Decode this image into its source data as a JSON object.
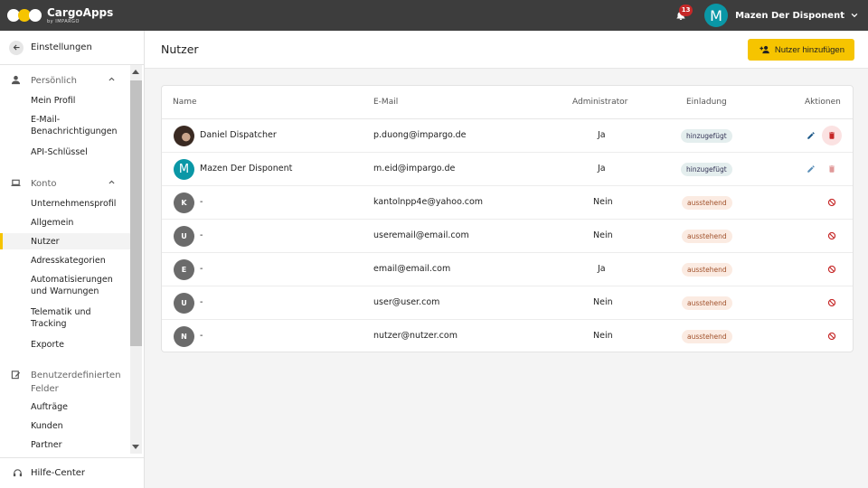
{
  "topbar": {
    "app_name": "CargoApps",
    "app_sub": "by IMPARGO",
    "notification_count": "13",
    "user_initial": "M",
    "user_name": "Mazen Der Disponent"
  },
  "sidebar": {
    "back_label": "Einstellungen",
    "sections": {
      "personal": {
        "label": "Persönlich",
        "items": [
          "Mein Profil",
          "E-Mail-Benachrichtigungen",
          "API-Schlüssel"
        ]
      },
      "account": {
        "label": "Konto",
        "items": [
          "Unternehmensprofil",
          "Allgemein",
          "Nutzer",
          "Adresskategorien",
          "Automatisierungen und Warnungen",
          "Telematik und Tracking",
          "Exporte"
        ]
      },
      "custom": {
        "label": "Benutzerdefinierten Felder",
        "items": [
          "Aufträge",
          "Kunden",
          "Partner"
        ]
      }
    },
    "active_item": "Nutzer",
    "help_label": "Hilfe-Center"
  },
  "main": {
    "title": "Nutzer",
    "add_button_label": "Nutzer hinzufügen"
  },
  "table": {
    "columns": [
      "Name",
      "E-Mail",
      "Administrator",
      "Einladung",
      "Aktionen"
    ],
    "rows": [
      {
        "initial": "",
        "avatar": "photo",
        "name": "Daniel Dispatcher",
        "email": "p.duong@impargo.de",
        "admin": "Ja",
        "invitation": "hinzugefügt",
        "status": "ok",
        "actions": "edit-delete-active"
      },
      {
        "initial": "M",
        "avatar": "teal",
        "name": "Mazen Der Disponent",
        "email": "m.eid@impargo.de",
        "admin": "Ja",
        "invitation": "hinzugefügt",
        "status": "ok",
        "actions": "edit-delete-muted"
      },
      {
        "initial": "K",
        "avatar": "gray",
        "name": "-",
        "email": "kantolnpp4e@yahoo.com",
        "admin": "Nein",
        "invitation": "ausstehend",
        "status": "pending",
        "actions": "revoke"
      },
      {
        "initial": "U",
        "avatar": "gray",
        "name": "-",
        "email": "useremail@email.com",
        "admin": "Nein",
        "invitation": "ausstehend",
        "status": "pending",
        "actions": "revoke"
      },
      {
        "initial": "E",
        "avatar": "gray",
        "name": "-",
        "email": "email@email.com",
        "admin": "Ja",
        "invitation": "ausstehend",
        "status": "pending",
        "actions": "revoke"
      },
      {
        "initial": "U",
        "avatar": "gray",
        "name": "-",
        "email": "user@user.com",
        "admin": "Nein",
        "invitation": "ausstehend",
        "status": "pending",
        "actions": "revoke"
      },
      {
        "initial": "N",
        "avatar": "gray",
        "name": "-",
        "email": "nutzer@nutzer.com",
        "admin": "Nein",
        "invitation": "ausstehend",
        "status": "pending",
        "actions": "revoke"
      }
    ]
  },
  "colors": {
    "topbar": "#3d3d3d",
    "accent": "#f6c400",
    "teal": "#0a97a6",
    "danger": "#c62828",
    "edit": "#1e5a8a"
  },
  "icons": {
    "bell": "bell-icon",
    "back": "arrow-left-icon",
    "personal": "person-icon",
    "account": "laptop-icon",
    "custom": "edit-note-icon",
    "help": "headset-icon",
    "add": "person-add-icon",
    "edit": "pencil-icon",
    "delete": "trash-icon",
    "revoke": "block-icon"
  }
}
